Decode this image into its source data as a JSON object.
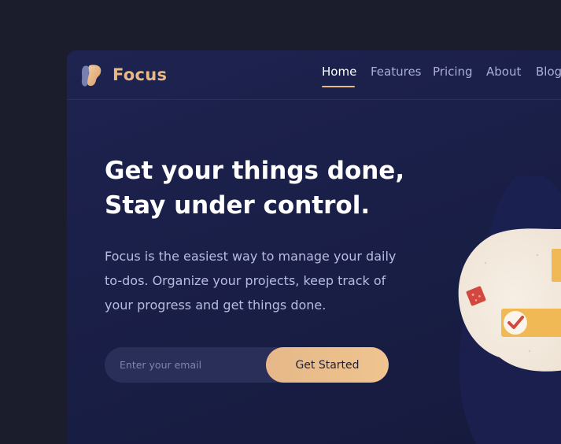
{
  "brand": {
    "name": "Focus"
  },
  "nav": {
    "items": [
      {
        "label": "Home",
        "active": true
      },
      {
        "label": "Features",
        "active": false
      },
      {
        "label": "Pricing",
        "active": false
      },
      {
        "label": "About",
        "active": false
      },
      {
        "label": "Blog",
        "active": false
      }
    ]
  },
  "hero": {
    "title_line1": "Get your things done,",
    "title_line2": "Stay under control.",
    "description_line1": "Focus is the easiest way to manage your daily",
    "description_line2": "to-dos. Organize your projects, keep track of",
    "description_line3": "your progress and get things done."
  },
  "signup": {
    "email_placeholder": "Enter your email",
    "email_value": "",
    "cta_label": "Get Started"
  },
  "icons": {
    "logo": "focus-logo-icon",
    "illustration": "task-checklist-illustration"
  },
  "colors": {
    "background": "#1b1d2c",
    "card": "#1e2350",
    "accent": "#e8b985",
    "text": "#ffffff",
    "muted": "#b7bde0"
  }
}
